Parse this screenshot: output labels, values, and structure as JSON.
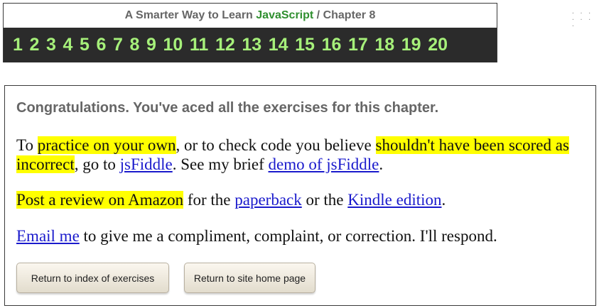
{
  "header": {
    "title_prefix": "A Smarter Way to Learn",
    "title_brand": "JavaScript",
    "title_separator": "/",
    "title_chapter": "Chapter 8",
    "chapters": [
      "1",
      "2",
      "3",
      "4",
      "5",
      "6",
      "7",
      "8",
      "9",
      "10",
      "11",
      "12",
      "13",
      "14",
      "15",
      "16",
      "17",
      "18",
      "19",
      "20"
    ]
  },
  "corner_dots": "· · · · · · ·",
  "main": {
    "congrats": "Congratulations. You've aced all the exercises for this chapter.",
    "p1": {
      "t1": "To ",
      "h1": "practice on your own",
      "t2": ", or to check code you believe ",
      "h2": "shouldn't have been scored as incorrect",
      "t3": ", go to ",
      "link1": "jsFiddle",
      "t4": ". See my brief ",
      "link2": "demo of jsFiddle",
      "t5": "."
    },
    "p2": {
      "h1": "Post a review on Amazon",
      "t1": " for the ",
      "link1": "paperback",
      "t2": " or the ",
      "link2": "Kindle edition",
      "t3": "."
    },
    "p3": {
      "link1": "Email me",
      "t1": " to give me a compliment, complaint, or correction. I'll respond."
    },
    "buttons": {
      "index": "Return to index of exercises",
      "home": "Return to site home page"
    }
  },
  "colors": {
    "chapter_num": "#a6f07a",
    "chapter_bar": "#2b2b2b",
    "brand": "#2f8f2f",
    "highlight": "#ffff00",
    "link": "#1a1acc"
  }
}
